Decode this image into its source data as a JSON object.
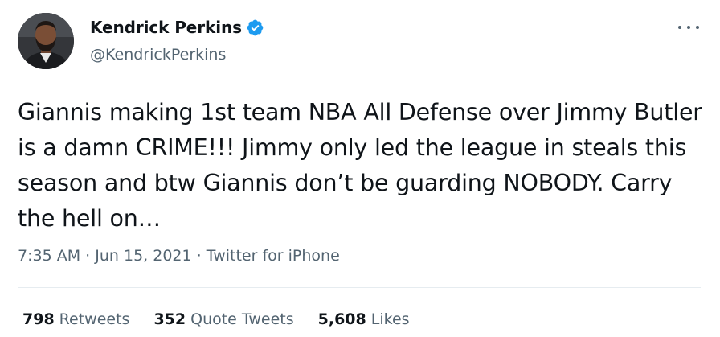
{
  "author": {
    "display_name": "Kendrick Perkins",
    "handle": "@KendrickPerkins",
    "verified": true,
    "avatar": "profile-photo"
  },
  "tweet": {
    "text": "Giannis making 1st team NBA All Defense over Jimmy Butler is a damn CRIME!!! Jimmy only led the league in steals this season and btw Giannis don’t be guarding NOBODY. Carry the hell on…",
    "time": "7:35 AM",
    "date": "Jun 15, 2021",
    "source": "Twitter for iPhone",
    "separator": "·"
  },
  "stats": {
    "retweets_count": "798",
    "retweets_label": "Retweets",
    "quote_tweets_count": "352",
    "quote_tweets_label": "Quote Tweets",
    "likes_count": "5,608",
    "likes_label": "Likes"
  },
  "colors": {
    "text": "#0f1419",
    "secondary": "#536471",
    "verified": "#1d9bf0",
    "divider": "#e6ecf0"
  },
  "icons": {
    "verified": "verified-badge-icon",
    "more": "more-options-icon"
  }
}
